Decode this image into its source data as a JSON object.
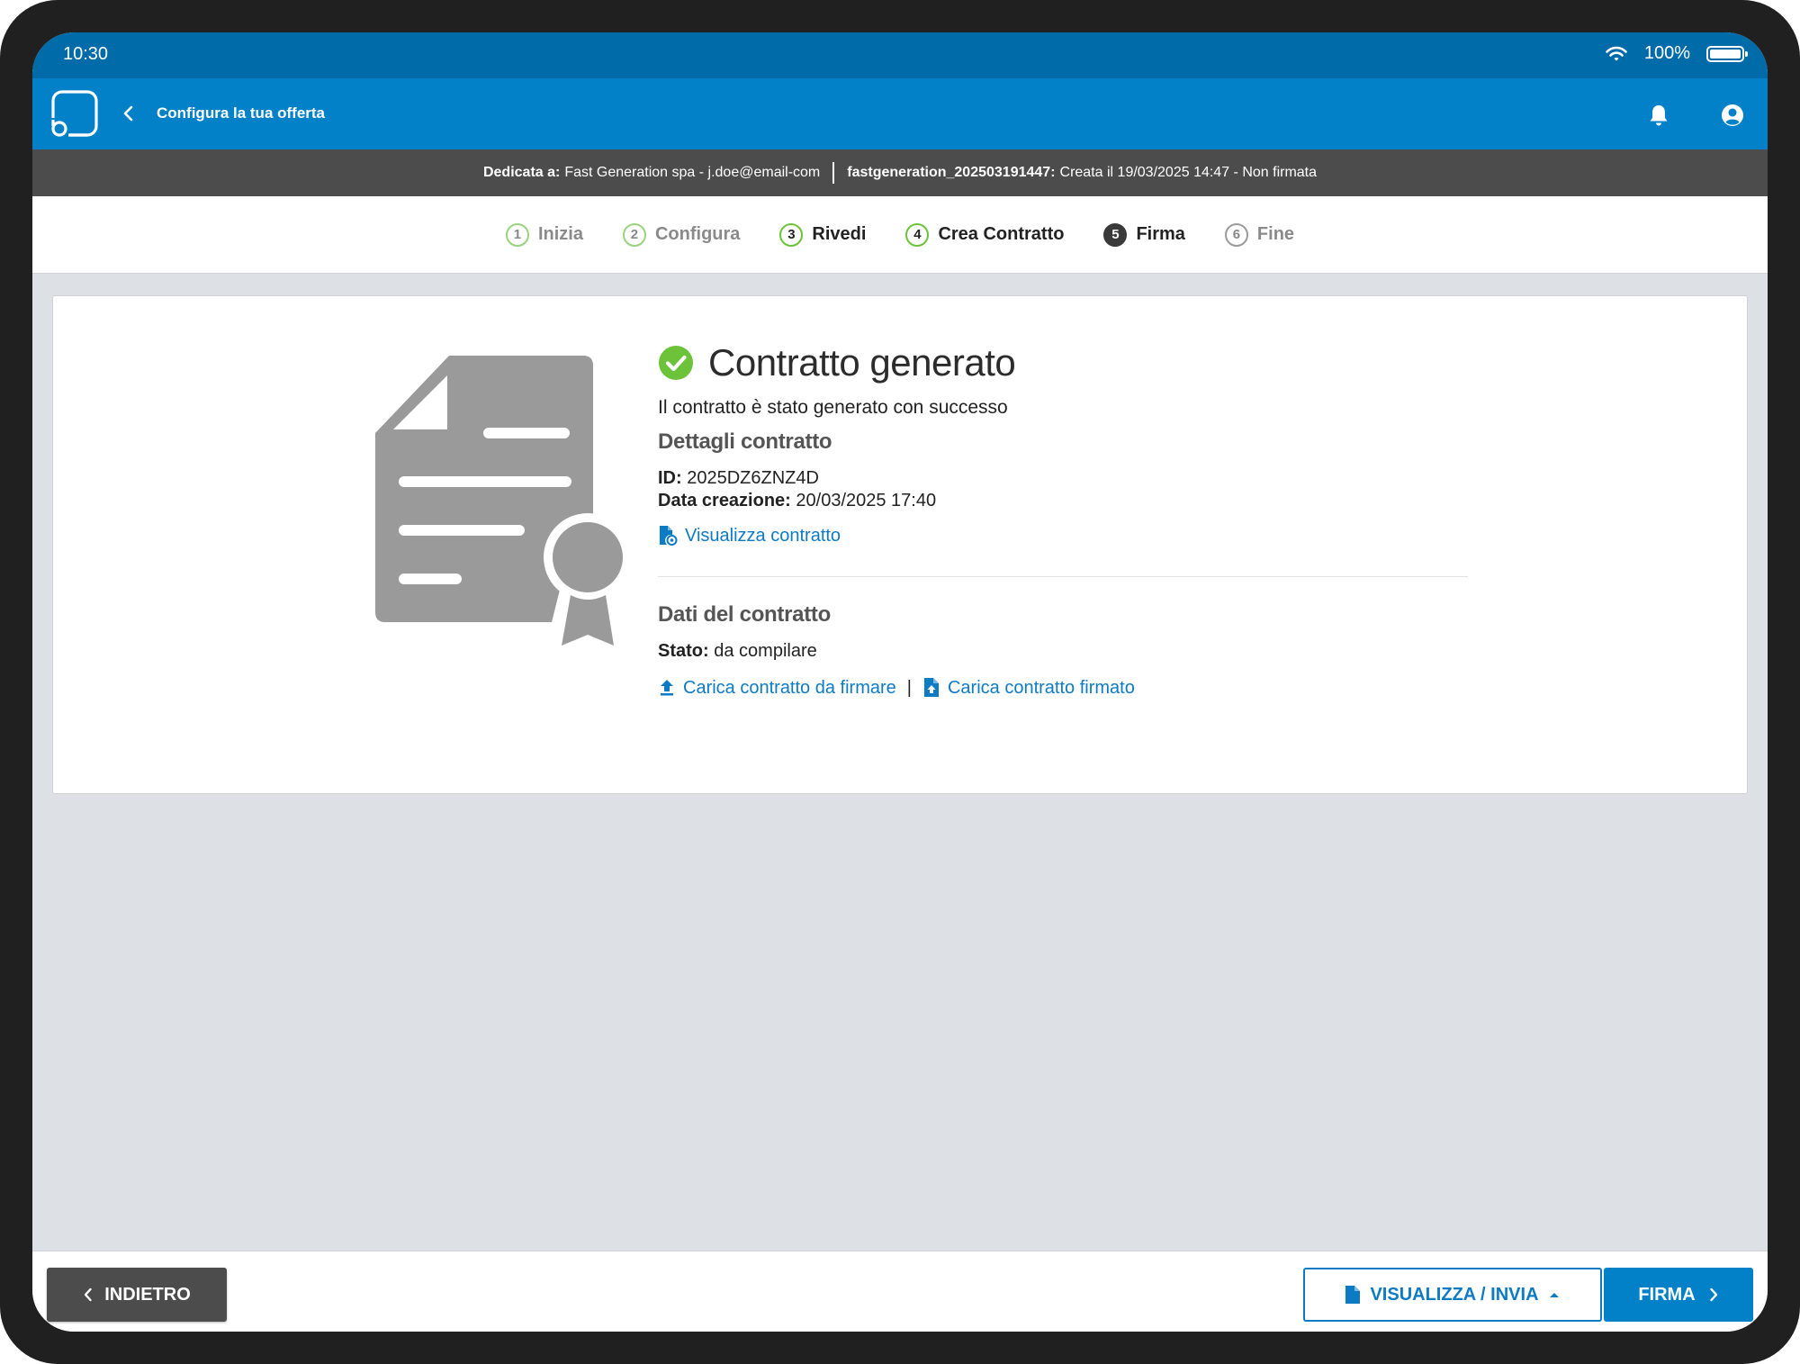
{
  "status_bar": {
    "time": "10:30",
    "battery": "100%"
  },
  "header": {
    "title": "Configura la tua offerta"
  },
  "info_bar": {
    "dedicated_label": "Dedicata a:",
    "dedicated_value": "Fast Generation spa - j.doe@email-com",
    "offer_id": "fastgeneration_202503191447:",
    "offer_status": "Creata il 19/03/2025 14:47 - Non firmata"
  },
  "stepper": {
    "steps": [
      {
        "num": "1",
        "label": "Inizia"
      },
      {
        "num": "2",
        "label": "Configura"
      },
      {
        "num": "3",
        "label": "Rivedi"
      },
      {
        "num": "4",
        "label": "Crea Contratto"
      },
      {
        "num": "5",
        "label": "Firma"
      },
      {
        "num": "6",
        "label": "Fine"
      }
    ]
  },
  "main": {
    "title": "Contratto generato",
    "subtitle": "Il contratto è stato generato con successo",
    "details_heading": "Dettagli contratto",
    "id_label": "ID:",
    "id_value": "2025DZ6ZNZ4D",
    "date_label": "Data creazione:",
    "date_value": "20/03/2025 17:40",
    "view_link": "Visualizza contratto",
    "data_heading": "Dati del contratto",
    "state_label": "Stato:",
    "state_value": "da compilare",
    "upload_to_sign_link": "Carica contratto da firmare",
    "separator": "|",
    "upload_signed_link": "Carica contratto firmato"
  },
  "footer": {
    "back_label": "INDIETRO",
    "view_send_label": "VISUALIZZA / INVIA",
    "sign_label": "FIRMA"
  },
  "colors": {
    "primary": "#0281c8",
    "status_bar": "#006ba9",
    "link": "#0c7bc4",
    "success": "#6cc33a",
    "dark_bar": "#4c4c4c"
  }
}
